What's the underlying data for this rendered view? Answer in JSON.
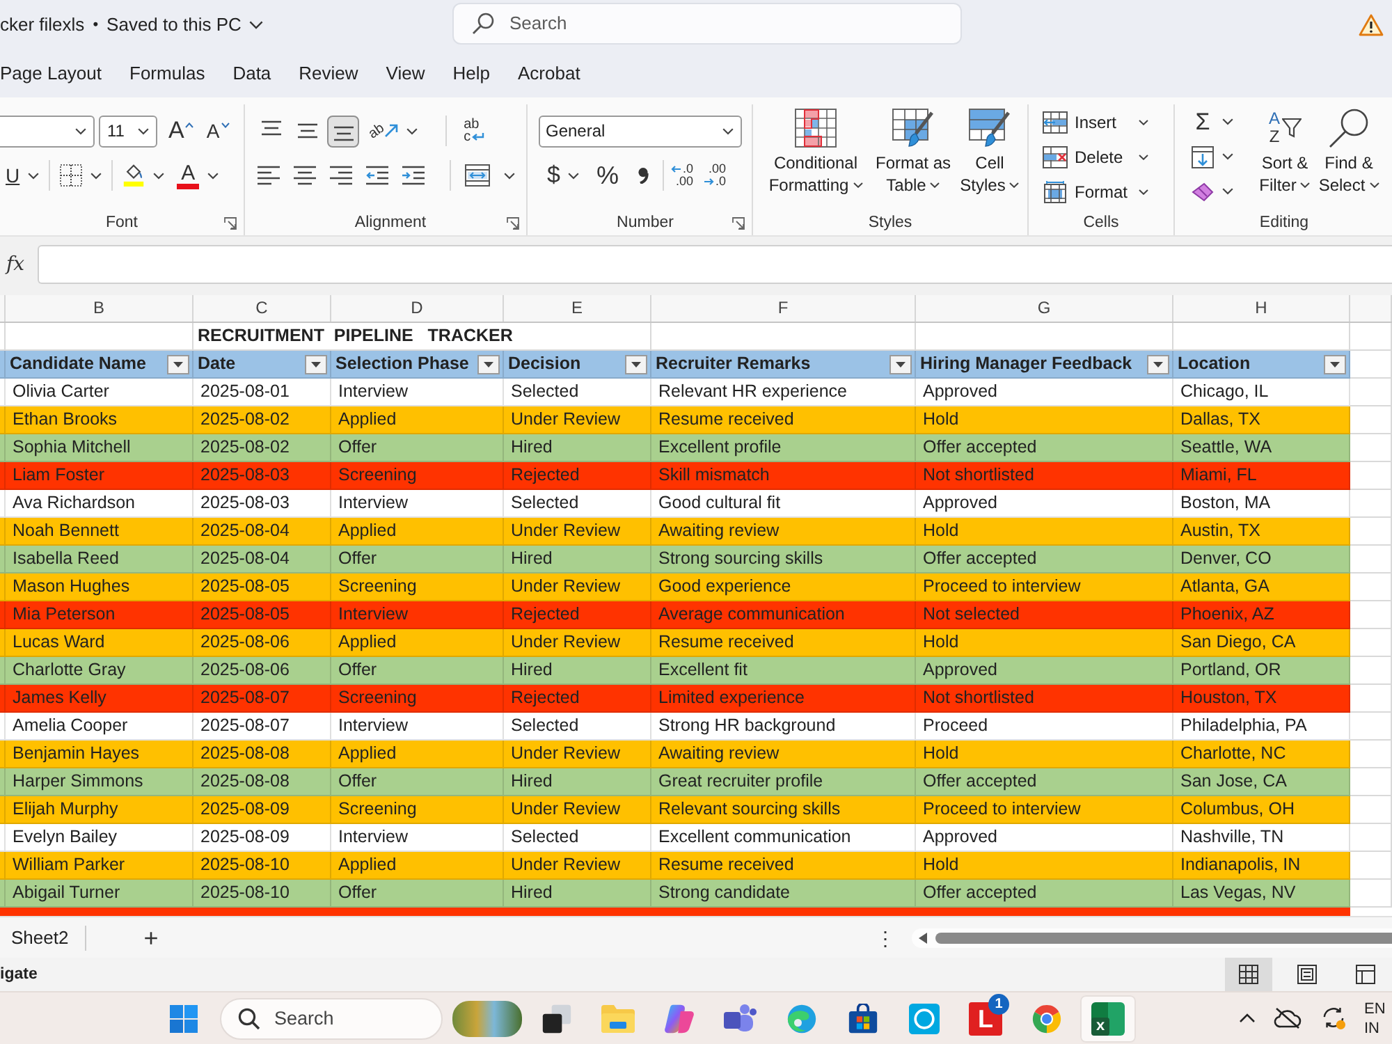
{
  "title_bar": {
    "file_name": "cker filexls",
    "separator": "•",
    "save_status": "Saved to this PC",
    "search": {
      "placeholder": "Search"
    }
  },
  "menu_tabs": [
    "Page Layout",
    "Formulas",
    "Data",
    "Review",
    "View",
    "Help",
    "Acrobat"
  ],
  "ribbon": {
    "font": {
      "label": "Font",
      "size": "11",
      "grow_glyph": "A",
      "shrink_glyph": "A",
      "underline_glyph": "U",
      "font_color_glyph": "A"
    },
    "alignment": {
      "label": "Alignment",
      "vertical_buttons": [
        {
          "kind": "top",
          "selected": false
        },
        {
          "kind": "middle",
          "selected": false
        },
        {
          "kind": "bottom",
          "selected": true
        }
      ],
      "orientation_glyph": "ab",
      "wrap_glyphs": [
        "ab",
        "c"
      ]
    },
    "number": {
      "label": "Number",
      "format": "General",
      "currency_glyph": "$",
      "percent_glyph": "%",
      "increase_decimal_glyphs": [
        ".0",
        ".00"
      ],
      "decrease_decimal_glyphs": [
        ".00",
        ".0"
      ]
    },
    "styles": {
      "label": "Styles",
      "buttons": [
        {
          "kind": "conditional",
          "lines": [
            "Conditional",
            "Formatting"
          ]
        },
        {
          "kind": "table",
          "lines": [
            "Format as",
            "Table"
          ]
        },
        {
          "kind": "cell-styles",
          "lines": [
            "Cell",
            "Styles"
          ]
        }
      ]
    },
    "cells": {
      "label": "Cells",
      "buttons": [
        {
          "kind": "insert",
          "label": "Insert"
        },
        {
          "kind": "delete",
          "label": "Delete"
        },
        {
          "kind": "format",
          "label": "Format"
        }
      ]
    },
    "editing": {
      "label": "Editing",
      "autosum_glyph": "Σ",
      "buttons": [
        {
          "kind": "sort",
          "lines": [
            "Sort &",
            "Filter"
          ],
          "glyphs": [
            "A",
            "Z"
          ]
        },
        {
          "kind": "find",
          "lines": [
            "Find &",
            "Select"
          ]
        }
      ]
    }
  },
  "formula_bar": {
    "function_label": "fx"
  },
  "column_letters": [
    "B",
    "C",
    "D",
    "E",
    "F",
    "G",
    "H"
  ],
  "table": {
    "title": "RECRUITMENT  PIPELINE   TRACKER",
    "columns": [
      "Candidate Name",
      "Date",
      "Selection Phase",
      "Decision",
      "Recruiter Remarks",
      "Hiring Manager Feedback",
      "Location"
    ],
    "rows": [
      {
        "color": "#ffffff",
        "cells": [
          "Olivia Carter",
          "2025-08-01",
          "Interview",
          "Selected",
          "Relevant HR experience",
          "Approved",
          "Chicago, IL"
        ]
      },
      {
        "color": "#ffc000",
        "cells": [
          "Ethan Brooks",
          "2025-08-02",
          "Applied",
          "Under Review",
          "Resume received",
          "Hold",
          "Dallas, TX"
        ]
      },
      {
        "color": "#a9d08e",
        "cells": [
          "Sophia Mitchell",
          "2025-08-02",
          "Offer",
          "Hired",
          "Excellent profile",
          "Offer accepted",
          "Seattle, WA"
        ]
      },
      {
        "color": "#ff3300",
        "cells": [
          "Liam Foster",
          "2025-08-03",
          "Screening",
          "Rejected",
          "Skill mismatch",
          "Not shortlisted",
          "Miami, FL"
        ]
      },
      {
        "color": "#ffffff",
        "cells": [
          "Ava Richardson",
          "2025-08-03",
          "Interview",
          "Selected",
          "Good cultural fit",
          "Approved",
          "Boston, MA"
        ]
      },
      {
        "color": "#ffc000",
        "cells": [
          "Noah Bennett",
          "2025-08-04",
          "Applied",
          "Under Review",
          "Awaiting review",
          "Hold",
          "Austin, TX"
        ]
      },
      {
        "color": "#a9d08e",
        "cells": [
          "Isabella Reed",
          "2025-08-04",
          "Offer",
          "Hired",
          "Strong sourcing skills",
          "Offer accepted",
          "Denver, CO"
        ]
      },
      {
        "color": "#ffc000",
        "cells": [
          "Mason Hughes",
          "2025-08-05",
          "Screening",
          "Under Review",
          "Good experience",
          "Proceed to interview",
          "Atlanta, GA"
        ]
      },
      {
        "color": "#ff3300",
        "cells": [
          "Mia Peterson",
          "2025-08-05",
          "Interview",
          "Rejected",
          "Average communication",
          "Not selected",
          "Phoenix, AZ"
        ]
      },
      {
        "color": "#ffc000",
        "cells": [
          "Lucas Ward",
          "2025-08-06",
          "Applied",
          "Under Review",
          "Resume received",
          "Hold",
          "San Diego, CA"
        ]
      },
      {
        "color": "#a9d08e",
        "cells": [
          "Charlotte Gray",
          "2025-08-06",
          "Offer",
          "Hired",
          "Excellent fit",
          "Approved",
          "Portland, OR"
        ]
      },
      {
        "color": "#ff3300",
        "cells": [
          "James Kelly",
          "2025-08-07",
          "Screening",
          "Rejected",
          "Limited experience",
          "Not shortlisted",
          "Houston, TX"
        ]
      },
      {
        "color": "#ffffff",
        "cells": [
          "Amelia Cooper",
          "2025-08-07",
          "Interview",
          "Selected",
          "Strong HR background",
          "Proceed",
          "Philadelphia, PA"
        ]
      },
      {
        "color": "#ffc000",
        "cells": [
          "Benjamin Hayes",
          "2025-08-08",
          "Applied",
          "Under Review",
          "Awaiting review",
          "Hold",
          "Charlotte, NC"
        ]
      },
      {
        "color": "#a9d08e",
        "cells": [
          "Harper Simmons",
          "2025-08-08",
          "Offer",
          "Hired",
          "Great recruiter profile",
          "Offer accepted",
          "San Jose, CA"
        ]
      },
      {
        "color": "#ffc000",
        "cells": [
          "Elijah Murphy",
          "2025-08-09",
          "Screening",
          "Under Review",
          "Relevant sourcing skills",
          "Proceed to interview",
          "Columbus, OH"
        ]
      },
      {
        "color": "#ffffff",
        "cells": [
          "Evelyn Bailey",
          "2025-08-09",
          "Interview",
          "Selected",
          "Excellent communication",
          "Approved",
          "Nashville, TN"
        ]
      },
      {
        "color": "#ffc000",
        "cells": [
          "William Parker",
          "2025-08-10",
          "Applied",
          "Under Review",
          "Resume received",
          "Hold",
          "Indianapolis, IN"
        ]
      },
      {
        "color": "#a9d08e",
        "cells": [
          "Abigail Turner",
          "2025-08-10",
          "Offer",
          "Hired",
          "Strong candidate",
          "Offer accepted",
          "Las Vegas, NV"
        ]
      }
    ],
    "clipped_row": {
      "color": "#ff3300"
    }
  },
  "sheet_bar": {
    "tabs": [
      "Sheet2"
    ],
    "add_button": "+",
    "more_button": "⋮"
  },
  "status_bar": {
    "text": "igate",
    "view_buttons": [
      {
        "kind": "normal",
        "selected": true
      },
      {
        "kind": "page-layout",
        "selected": false
      },
      {
        "kind": "page-break",
        "selected": false
      }
    ]
  },
  "taskbar": {
    "search": {
      "placeholder": "Search"
    },
    "apps": [
      {
        "kind": "task-view",
        "selected": false
      },
      {
        "kind": "folder",
        "selected": false
      },
      {
        "kind": "swirl",
        "selected": false
      },
      {
        "kind": "people",
        "selected": false
      },
      {
        "kind": "wave-globe",
        "selected": false
      },
      {
        "kind": "bag",
        "selected": false
      },
      {
        "kind": "ring",
        "selected": false
      },
      {
        "kind": "letter",
        "glyph": "L",
        "badge": "1",
        "selected": false
      },
      {
        "kind": "tricolor",
        "selected": false
      },
      {
        "kind": "spreadsheet",
        "glyph": "x",
        "selected": true
      }
    ],
    "language": [
      "EN",
      "IN"
    ]
  }
}
